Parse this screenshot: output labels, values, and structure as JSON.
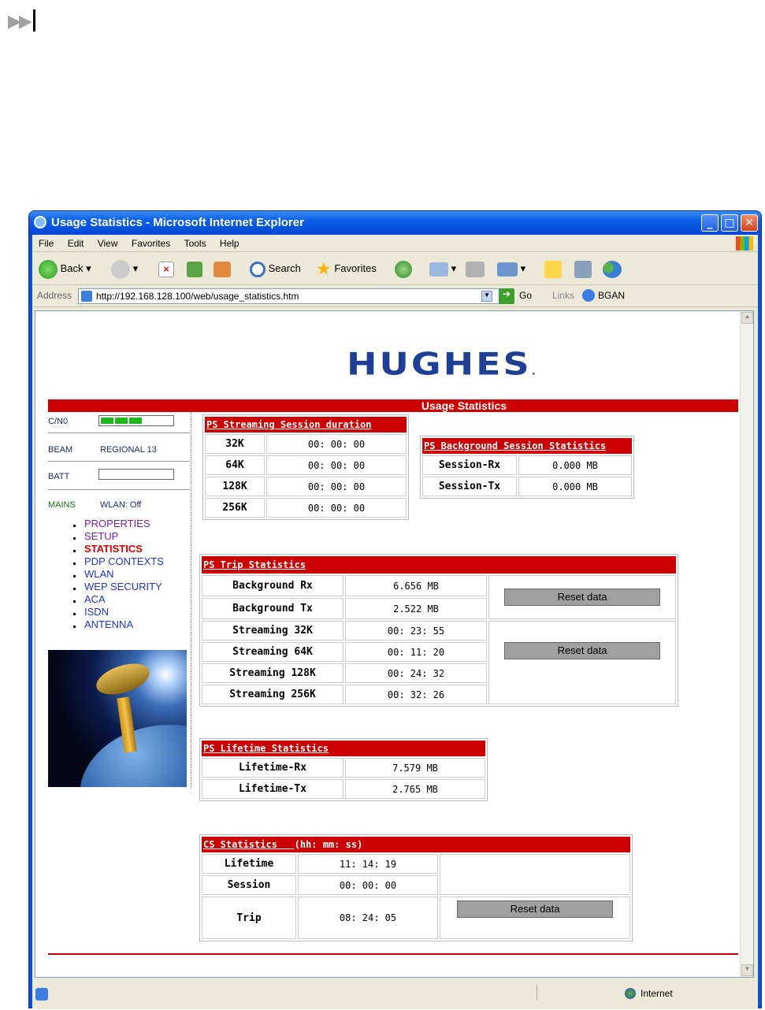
{
  "browser": {
    "title": "Usage Statistics - Microsoft Internet Explorer",
    "menu": [
      "File",
      "Edit",
      "View",
      "Favorites",
      "Tools",
      "Help"
    ],
    "toolbar": {
      "back": "Back",
      "search": "Search",
      "favorites": "Favorites"
    },
    "address_label": "Address",
    "address": "http://192.168.128.100/web/usage_statistics.htm",
    "go": "Go",
    "links_label": "Links",
    "links_item": "BGAN",
    "status_zone": "Internet"
  },
  "page": {
    "logo": "HUGHES",
    "logo_mark": ".",
    "heading": "Usage Statistics",
    "sidebar": {
      "cn0_label": "C/N0",
      "beam_label": "BEAM",
      "beam_value": "REGIONAL 13",
      "batt_label": "BATT",
      "mains_label": "MAINS",
      "wlan_label": "WLAN: Off",
      "nav": [
        "PROPERTIES",
        "SETUP",
        "STATISTICS",
        "PDP CONTEXTS",
        "WLAN",
        "WEP SECURITY",
        "ACA",
        "ISDN",
        "ANTENNA"
      ]
    },
    "streaming": {
      "title": "PS Streaming Session duration",
      "rows": [
        [
          "32K",
          "00: 00: 00"
        ],
        [
          "64K",
          "00: 00: 00"
        ],
        [
          "128K",
          "00: 00: 00"
        ],
        [
          "256K",
          "00: 00: 00"
        ]
      ]
    },
    "background": {
      "title": "PS Background Session Statistics",
      "rows": [
        [
          "Session-Rx",
          "0.000 MB"
        ],
        [
          "Session-Tx",
          "0.000 MB"
        ]
      ]
    },
    "trip": {
      "title": "PS Trip Statistics",
      "rows": [
        [
          "Background Rx",
          "6.656 MB"
        ],
        [
          "Background Tx",
          "2.522 MB"
        ],
        [
          "Streaming 32K",
          "00: 23: 55"
        ],
        [
          "Streaming 64K",
          "00: 11: 20"
        ],
        [
          "Streaming 128K",
          "00: 24: 32"
        ],
        [
          "Streaming 256K",
          "00: 32: 26"
        ]
      ],
      "reset1": "Reset data",
      "reset2": "Reset data"
    },
    "lifetime": {
      "title": "PS Lifetime Statistics",
      "rows": [
        [
          "Lifetime-Rx",
          "7.579 MB"
        ],
        [
          "Lifetime-Tx",
          "2.765 MB"
        ]
      ]
    },
    "cs": {
      "title": "CS Statistics",
      "title_suffix": "(hh: mm: ss)",
      "rows": [
        [
          "Lifetime",
          "11: 14: 19"
        ],
        [
          "Session",
          "00: 00: 00"
        ],
        [
          "Trip",
          "08: 24: 05"
        ]
      ],
      "reset": "Reset data"
    }
  },
  "colors": {
    "accent_red": "#cc0000",
    "xp_blue": "#0a53d8",
    "logo_blue": "#1f3f95"
  }
}
